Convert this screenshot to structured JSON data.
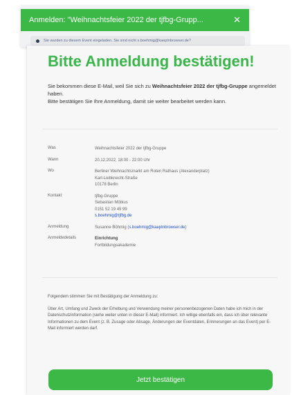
{
  "modal": {
    "title": "Anmelden: \"Weihnachtsfeier 2022 der tjfbg-Grupp...",
    "close_icon": "close-icon",
    "notice": "Sie wurden zu diesem Event eingeladen. Sie sind nicht s.boehmig@kaeptnbrowser.de?"
  },
  "email": {
    "headline": "Bitte Anmeldung bestätigen!",
    "intro_part1": "Sie bekommen diese E-Mail, weil Sie sich zu ",
    "intro_event": "Weihnachtsfeier 2022 der tjfbg-Gruppe",
    "intro_part2": " angemeldet haben.",
    "intro_line2": "Bitte bestätigen Sie Ihre Anmeldung, damit sie weiter bearbeitet werden kann.",
    "details": {
      "was_label": "Was",
      "was_value": "Weihnachtsfeier 2022 der tjfbg-Gruppe",
      "wann_label": "Wann",
      "wann_value": "20.12.2022, 18:00 - 22:00 Uhr",
      "wo_label": "Wo",
      "wo_line1": "Berliner Weihnachtsmarkt am Roten Rathaus (Alexanderplatz)",
      "wo_line2": "Karl-Liebknecht-Straße",
      "wo_line3": "10178 Berlin",
      "kontakt_label": "Kontakt",
      "kontakt_line1": "tjfbg-Gruppe",
      "kontakt_line2": "Sebastian Möbius",
      "kontakt_line3": "0151 52 19 49 99",
      "kontakt_email": "s.boehmig@tjfbg.de",
      "anmeldung_label": "Anmeldung",
      "anmeldung_name": "Susanne Böhmig (",
      "anmeldung_email": "s.boehmig@kaeptnbrowser.de",
      "anmeldung_close": ")",
      "anmeldedetails_label": "Anmeldedetails",
      "anmeldedetails_line1": "Einrichtung",
      "anmeldedetails_line2": "Fortbildungsakademie"
    },
    "consent_lead": "Folgendem stimmen Sie mit Bestätigung der Anmeldung zu:",
    "consent_text": "Über Art, Umfang und Zweck der Erhebung und Verwendung meiner personenbezogenen Daten habe ich mich in der Datenschutzinformation (siehe weiter unten in dieser E-Mail) informiert. Ich willige ebenfalls ein, dass ich über relevante Informationen zu dem Event (z. B. Zusage oder Absage, Änderungen der Eventdaten, Erinnerungen an das Event) per E-Mail informiert werden darf.",
    "confirm_button": "Jetzt bestätigen"
  },
  "colors": {
    "brand_green": "#3cb846",
    "headline_green": "#3ab54a",
    "link_blue": "#1a4dd1"
  }
}
